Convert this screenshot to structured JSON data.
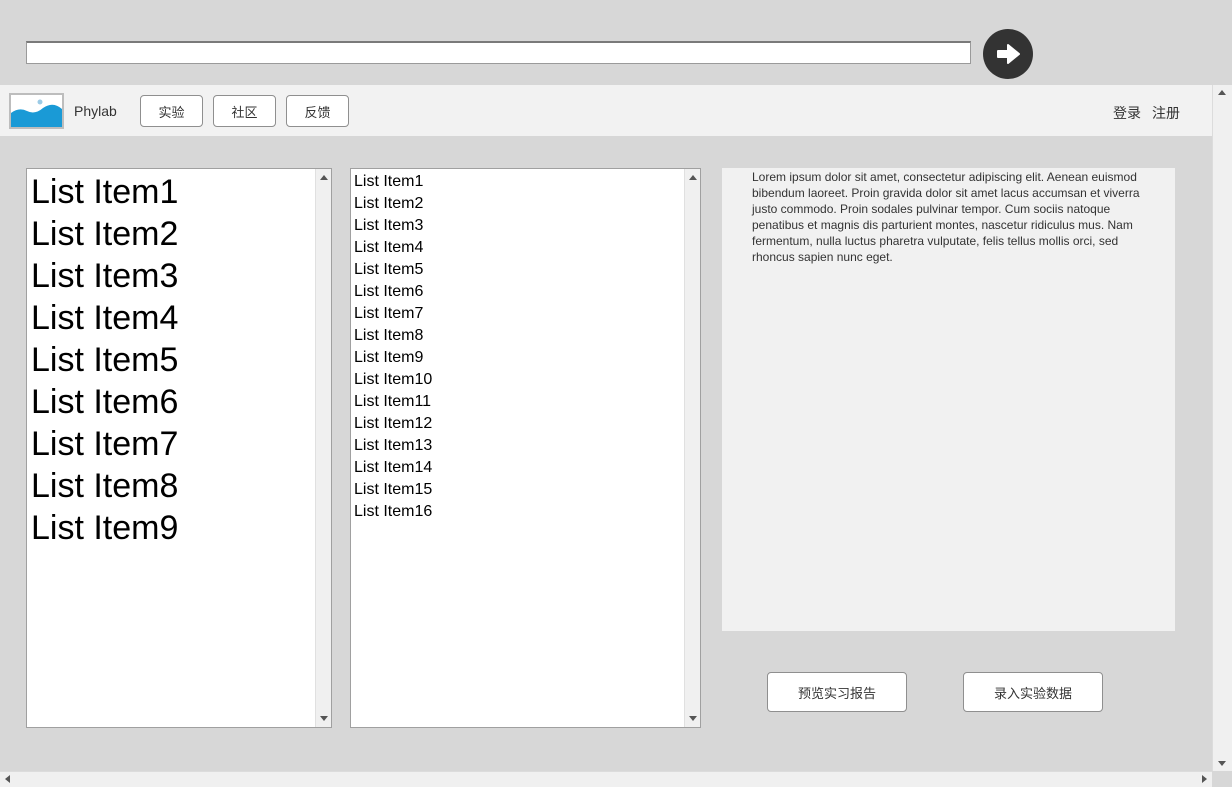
{
  "address_bar": {
    "value": "",
    "go_icon": "arrow-right-circle-icon"
  },
  "navbar": {
    "logo_icon": "image-placeholder-icon",
    "brand": "Phylab",
    "tabs": [
      {
        "label": "实验"
      },
      {
        "label": "社区"
      },
      {
        "label": "反馈"
      }
    ],
    "login": "登录",
    "register": "注册"
  },
  "list_left": {
    "items": [
      "List Item1",
      "List Item2",
      "List Item3",
      "List Item4",
      "List Item5",
      "List Item6",
      "List Item7",
      "List Item8",
      "List Item9"
    ]
  },
  "list_right": {
    "items": [
      "List Item1",
      "List Item2",
      "List Item3",
      "List Item4",
      "List Item5",
      "List Item6",
      "List Item7",
      "List Item8",
      "List Item9",
      "List Item10",
      "List Item11",
      "List Item12",
      "List Item13",
      "List Item14",
      "List Item15",
      "List Item16"
    ]
  },
  "text_panel": {
    "body": "Lorem ipsum dolor sit amet, consectetur adipiscing elit. Aenean euismod bibendum laoreet. Proin gravida dolor sit amet lacus accumsan et viverra justo commodo. Proin sodales pulvinar tempor. Cum sociis natoque penatibus et magnis dis parturient montes, nascetur ridiculus mus. Nam fermentum, nulla luctus pharetra vulputate, felis tellus mollis orci, sed rhoncus sapien nunc eget."
  },
  "actions": {
    "preview_report": "预览实习报告",
    "enter_data": "录入实验数据"
  },
  "colors": {
    "background": "#d7d7d7",
    "navbar": "#f2f2f2",
    "logo_blue": "#1a9ad6",
    "go_button": "#333333"
  }
}
